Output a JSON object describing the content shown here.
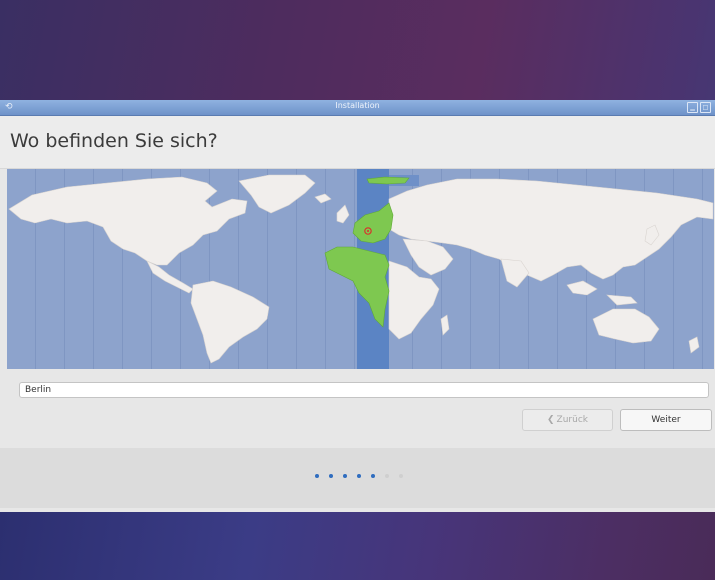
{
  "window": {
    "title": "Installation",
    "icon": "installer-icon",
    "controls": [
      "minimize-icon",
      "maximize-icon"
    ]
  },
  "page": {
    "heading": "Wo befinden Sie sich?"
  },
  "location": {
    "value": "Berlin"
  },
  "buttons": {
    "back_label": "Zurück",
    "next_label": "Weiter"
  },
  "progress": {
    "total_steps": 7,
    "completed_steps": 5
  },
  "colors": {
    "accent": "#2f6dbf",
    "highlighted_timezone": "#7ec850",
    "map_ocean": "#8da3cc",
    "timezone_band": "#5b84c4"
  }
}
